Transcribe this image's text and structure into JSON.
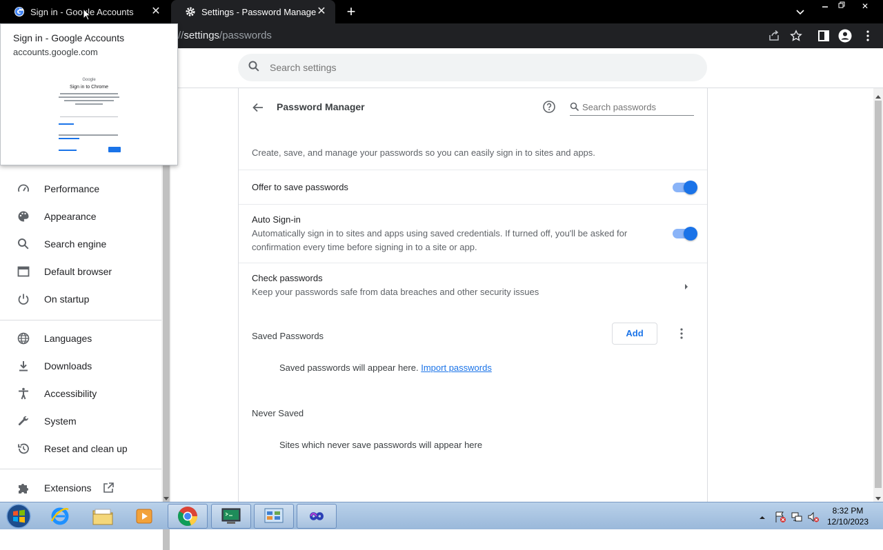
{
  "browser": {
    "tabs": [
      {
        "title": "Sign in - Google Accounts",
        "active": false
      },
      {
        "title": "Settings - Password Manager",
        "active": true
      }
    ],
    "new_tab": "+",
    "url_prefix": "//",
    "url_bold": "settings",
    "url_rest": "/passwords"
  },
  "hover_card": {
    "title": "Sign in - Google Accounts",
    "domain": "accounts.google.com",
    "thumb_google": "Google",
    "thumb_heading": "Sign in to Chrome"
  },
  "header": {
    "search_placeholder": "Search settings"
  },
  "nav": {
    "items": [
      {
        "label": "Performance",
        "icon": "gauge-icon"
      },
      {
        "label": "Appearance",
        "icon": "palette-icon"
      },
      {
        "label": "Search engine",
        "icon": "search-icon"
      },
      {
        "label": "Default browser",
        "icon": "browser-window-icon"
      },
      {
        "label": "On startup",
        "icon": "power-icon"
      },
      {
        "label": "Languages",
        "icon": "globe-icon"
      },
      {
        "label": "Downloads",
        "icon": "download-icon"
      },
      {
        "label": "Accessibility",
        "icon": "accessibility-icon"
      },
      {
        "label": "System",
        "icon": "wrench-icon"
      },
      {
        "label": "Reset and clean up",
        "icon": "history-icon"
      },
      {
        "label": "Extensions",
        "icon": "puzzle-icon"
      }
    ]
  },
  "page": {
    "title": "Password Manager",
    "search_passwords_placeholder": "Search passwords",
    "description": "Create, save, and manage your passwords so you can easily sign in to sites and apps.",
    "offer_to_save": {
      "label": "Offer to save passwords",
      "enabled": true
    },
    "auto_signin": {
      "label": "Auto Sign-in",
      "desc_line1": "Automatically sign in to sites and apps using saved credentials. If turned off, you'll be asked for",
      "desc_line2": "confirmation every time before signing in to a site or app.",
      "enabled": true
    },
    "check_passwords": {
      "label": "Check passwords",
      "desc": "Keep your passwords safe from data breaches and other security issues"
    },
    "saved_passwords": {
      "heading": "Saved Passwords",
      "add_label": "Add",
      "empty_text": "Saved passwords will appear here.",
      "import_link": "Import passwords"
    },
    "never_saved": {
      "heading": "Never Saved",
      "empty_text": "Sites which never save passwords will appear here"
    }
  },
  "taskbar": {
    "time": "8:32 PM",
    "date": "12/10/2023"
  },
  "colors": {
    "accent": "#1a73e8",
    "toggle_track": "#8ab4f8"
  }
}
